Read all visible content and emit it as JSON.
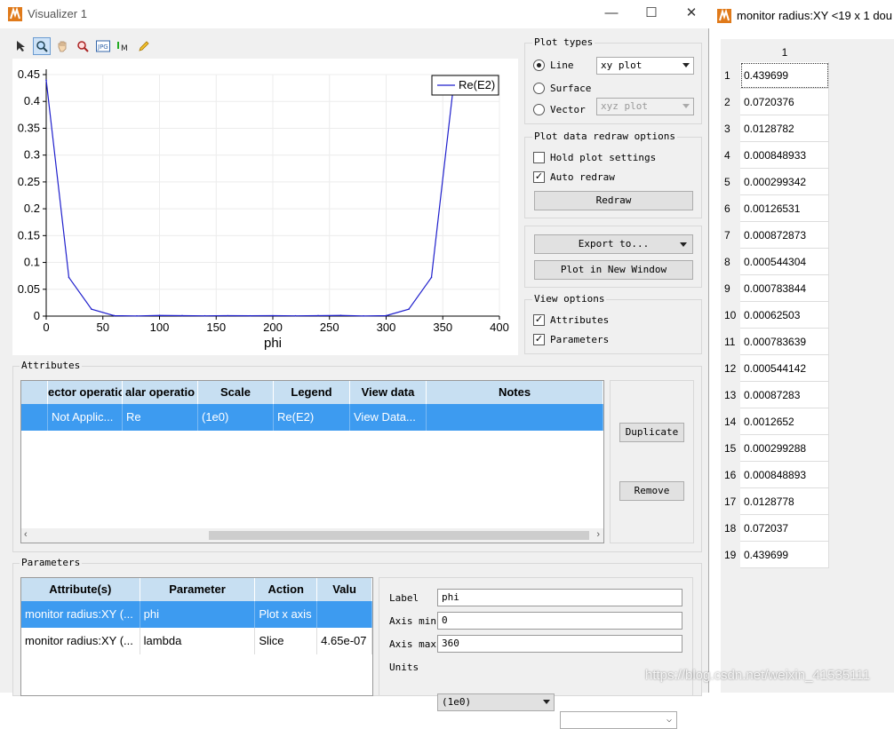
{
  "visualizer": {
    "title": "Visualizer 1",
    "window_controls": {
      "minimize": "—",
      "maximize": "☐",
      "close": "✕"
    },
    "toolbar": [
      "pointer-tool",
      "zoom-tool",
      "pan-tool",
      "zoom-area-tool",
      "export-jpg-tool",
      "marker-tool",
      "pencil-tool"
    ]
  },
  "chart_data": {
    "type": "line",
    "xlabel": "phi",
    "ylabel": "",
    "xlim": [
      0,
      400
    ],
    "ylim": [
      0,
      0.45
    ],
    "xticks": [
      "0",
      "50",
      "100",
      "150",
      "200",
      "250",
      "300",
      "350",
      "400"
    ],
    "yticks": [
      "0",
      "0.05",
      "0.1",
      "0.15",
      "0.2",
      "0.25",
      "0.3",
      "0.35",
      "0.4",
      "0.45"
    ],
    "grid": true,
    "legend_position": "top-right",
    "series": [
      {
        "name": "Re(E2)",
        "color": "#1f1fcc",
        "x": [
          0,
          20,
          40,
          60,
          80,
          100,
          120,
          140,
          160,
          180,
          200,
          220,
          240,
          260,
          280,
          300,
          320,
          340,
          360
        ],
        "values": [
          0.439699,
          0.0720376,
          0.0128782,
          0.000848933,
          0.000299342,
          0.00126531,
          0.000872873,
          0.000544304,
          0.000783844,
          0.00062503,
          0.000783639,
          0.000544142,
          0.00087283,
          0.0012652,
          0.000299288,
          0.000848893,
          0.0128778,
          0.072037,
          0.439699
        ]
      }
    ]
  },
  "plot_types": {
    "title": "Plot types",
    "options": [
      {
        "label": "Line",
        "selected": true,
        "combo": "xy plot",
        "enabled": true
      },
      {
        "label": "Surface",
        "selected": false,
        "combo": "xyz plot",
        "enabled": false
      },
      {
        "label": "Vector",
        "selected": false
      }
    ]
  },
  "redraw_options": {
    "title": "Plot data redraw options",
    "hold_label": "Hold plot settings",
    "hold_checked": false,
    "auto_label": "Auto redraw",
    "auto_checked": true,
    "redraw_button": "Redraw"
  },
  "export": {
    "export_label": "Export to...",
    "new_window_button": "Plot in New Window"
  },
  "view_options": {
    "title": "View options",
    "attributes_label": "Attributes",
    "attributes_checked": true,
    "parameters_label": "Parameters",
    "parameters_checked": true
  },
  "attributes": {
    "title": "Attributes",
    "columns": [
      "ector operatio",
      "alar operatio",
      "Scale",
      "Legend",
      "View data",
      "Notes"
    ],
    "rows": [
      [
        "Not Applic...",
        "Re",
        "(1e0)",
        "Re(E2)",
        "View Data...",
        ""
      ]
    ],
    "duplicate_button": "Duplicate",
    "remove_button": "Remove"
  },
  "parameters": {
    "title": "Parameters",
    "columns": [
      "Attribute(s)",
      "Parameter",
      "Action",
      "Valu"
    ],
    "rows": [
      [
        "monitor radius:XY (...",
        "phi",
        "Plot x axis",
        ""
      ],
      [
        "monitor radius:XY (...",
        "lambda",
        "Slice",
        "4.65e-07"
      ]
    ],
    "label_label": "Label",
    "label_value": "phi",
    "axis_min_label": "Axis min",
    "axis_min_value": "0",
    "axis_max_label": "Axis max",
    "axis_max_value": "360",
    "units_label": "Units",
    "units_value": "(1e0)",
    "units2_value": ""
  },
  "data_window": {
    "title": "monitor radius:XY <19 x 1 dou",
    "column_header": "1",
    "row_numbers": [
      "1",
      "2",
      "3",
      "4",
      "5",
      "6",
      "7",
      "8",
      "9",
      "10",
      "11",
      "12",
      "13",
      "14",
      "15",
      "16",
      "17",
      "18",
      "19"
    ],
    "values": [
      "0.439699",
      "0.0720376",
      "0.0128782",
      "0.000848933",
      "0.000299342",
      "0.00126531",
      "0.000872873",
      "0.000544304",
      "0.000783844",
      "0.00062503",
      "0.000783639",
      "0.000544142",
      "0.00087283",
      "0.0012652",
      "0.000299288",
      "0.000848893",
      "0.0128778",
      "0.072037",
      "0.439699"
    ]
  },
  "watermark": "https://blog.csdn.net/weixin_41535111"
}
